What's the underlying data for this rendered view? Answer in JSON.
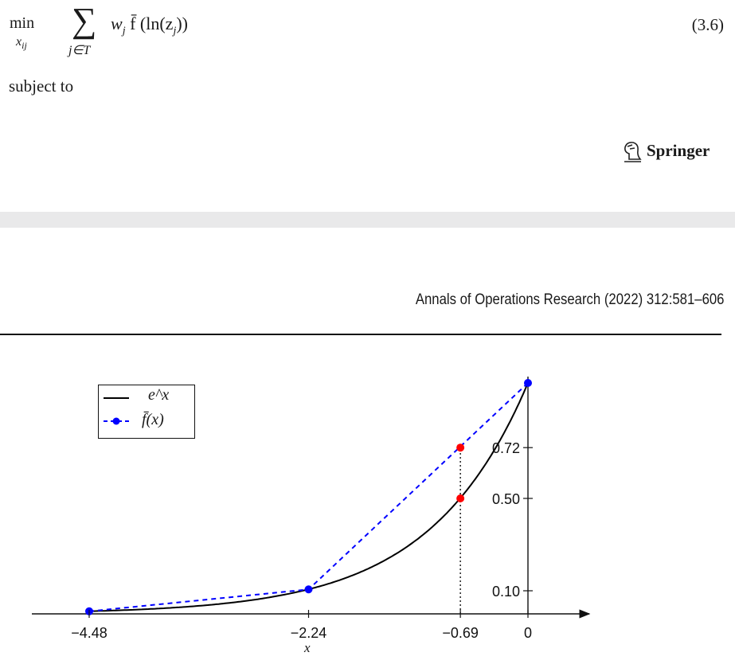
{
  "equation": {
    "min_label": "min",
    "min_subscript": "x",
    "min_subscript_index": "ij",
    "sum_symbol": "∑",
    "sum_subscript": "j∈T",
    "body": "w",
    "body_index": "j",
    "body_rest": " f̄ (ln(z",
    "body_z_index": "j",
    "body_close": "))",
    "number": "(3.6)"
  },
  "subject_to": "subject to",
  "publisher": {
    "name": "Springer",
    "logo_icon": "springer-knight-logo"
  },
  "journal_header": "Annals of Operations Research (2022) 312:581–606",
  "chart_data": {
    "type": "line",
    "xlabel": "x",
    "x_ticks": [
      -4.48,
      -2.24,
      -0.69,
      0
    ],
    "x_tick_labels": [
      "−4.48",
      "−2.24",
      "−0.69",
      "0"
    ],
    "y_ticks": [
      0.1,
      0.5,
      0.72
    ],
    "y_tick_labels": [
      "0.10",
      "0.50",
      "0.72"
    ],
    "xlim": [
      -4.9,
      0.55
    ],
    "ylim": [
      0,
      1.05
    ],
    "legend_position": "top-left",
    "series": [
      {
        "name": "e^x",
        "color": "#000000",
        "style": "solid",
        "function": "exp"
      },
      {
        "name": "f̄(x)",
        "color": "#0000ff",
        "style": "dashed",
        "markers": true,
        "x": [
          -4.48,
          -2.24,
          0
        ],
        "y": [
          0.011,
          0.106,
          1.0
        ]
      }
    ],
    "highlight_points": [
      {
        "x": -0.69,
        "y": 0.72,
        "color": "#ff0000"
      },
      {
        "x": -0.69,
        "y": 0.5,
        "color": "#ff0000"
      }
    ],
    "guide_line": {
      "x": -0.69,
      "style": "dotted"
    }
  }
}
